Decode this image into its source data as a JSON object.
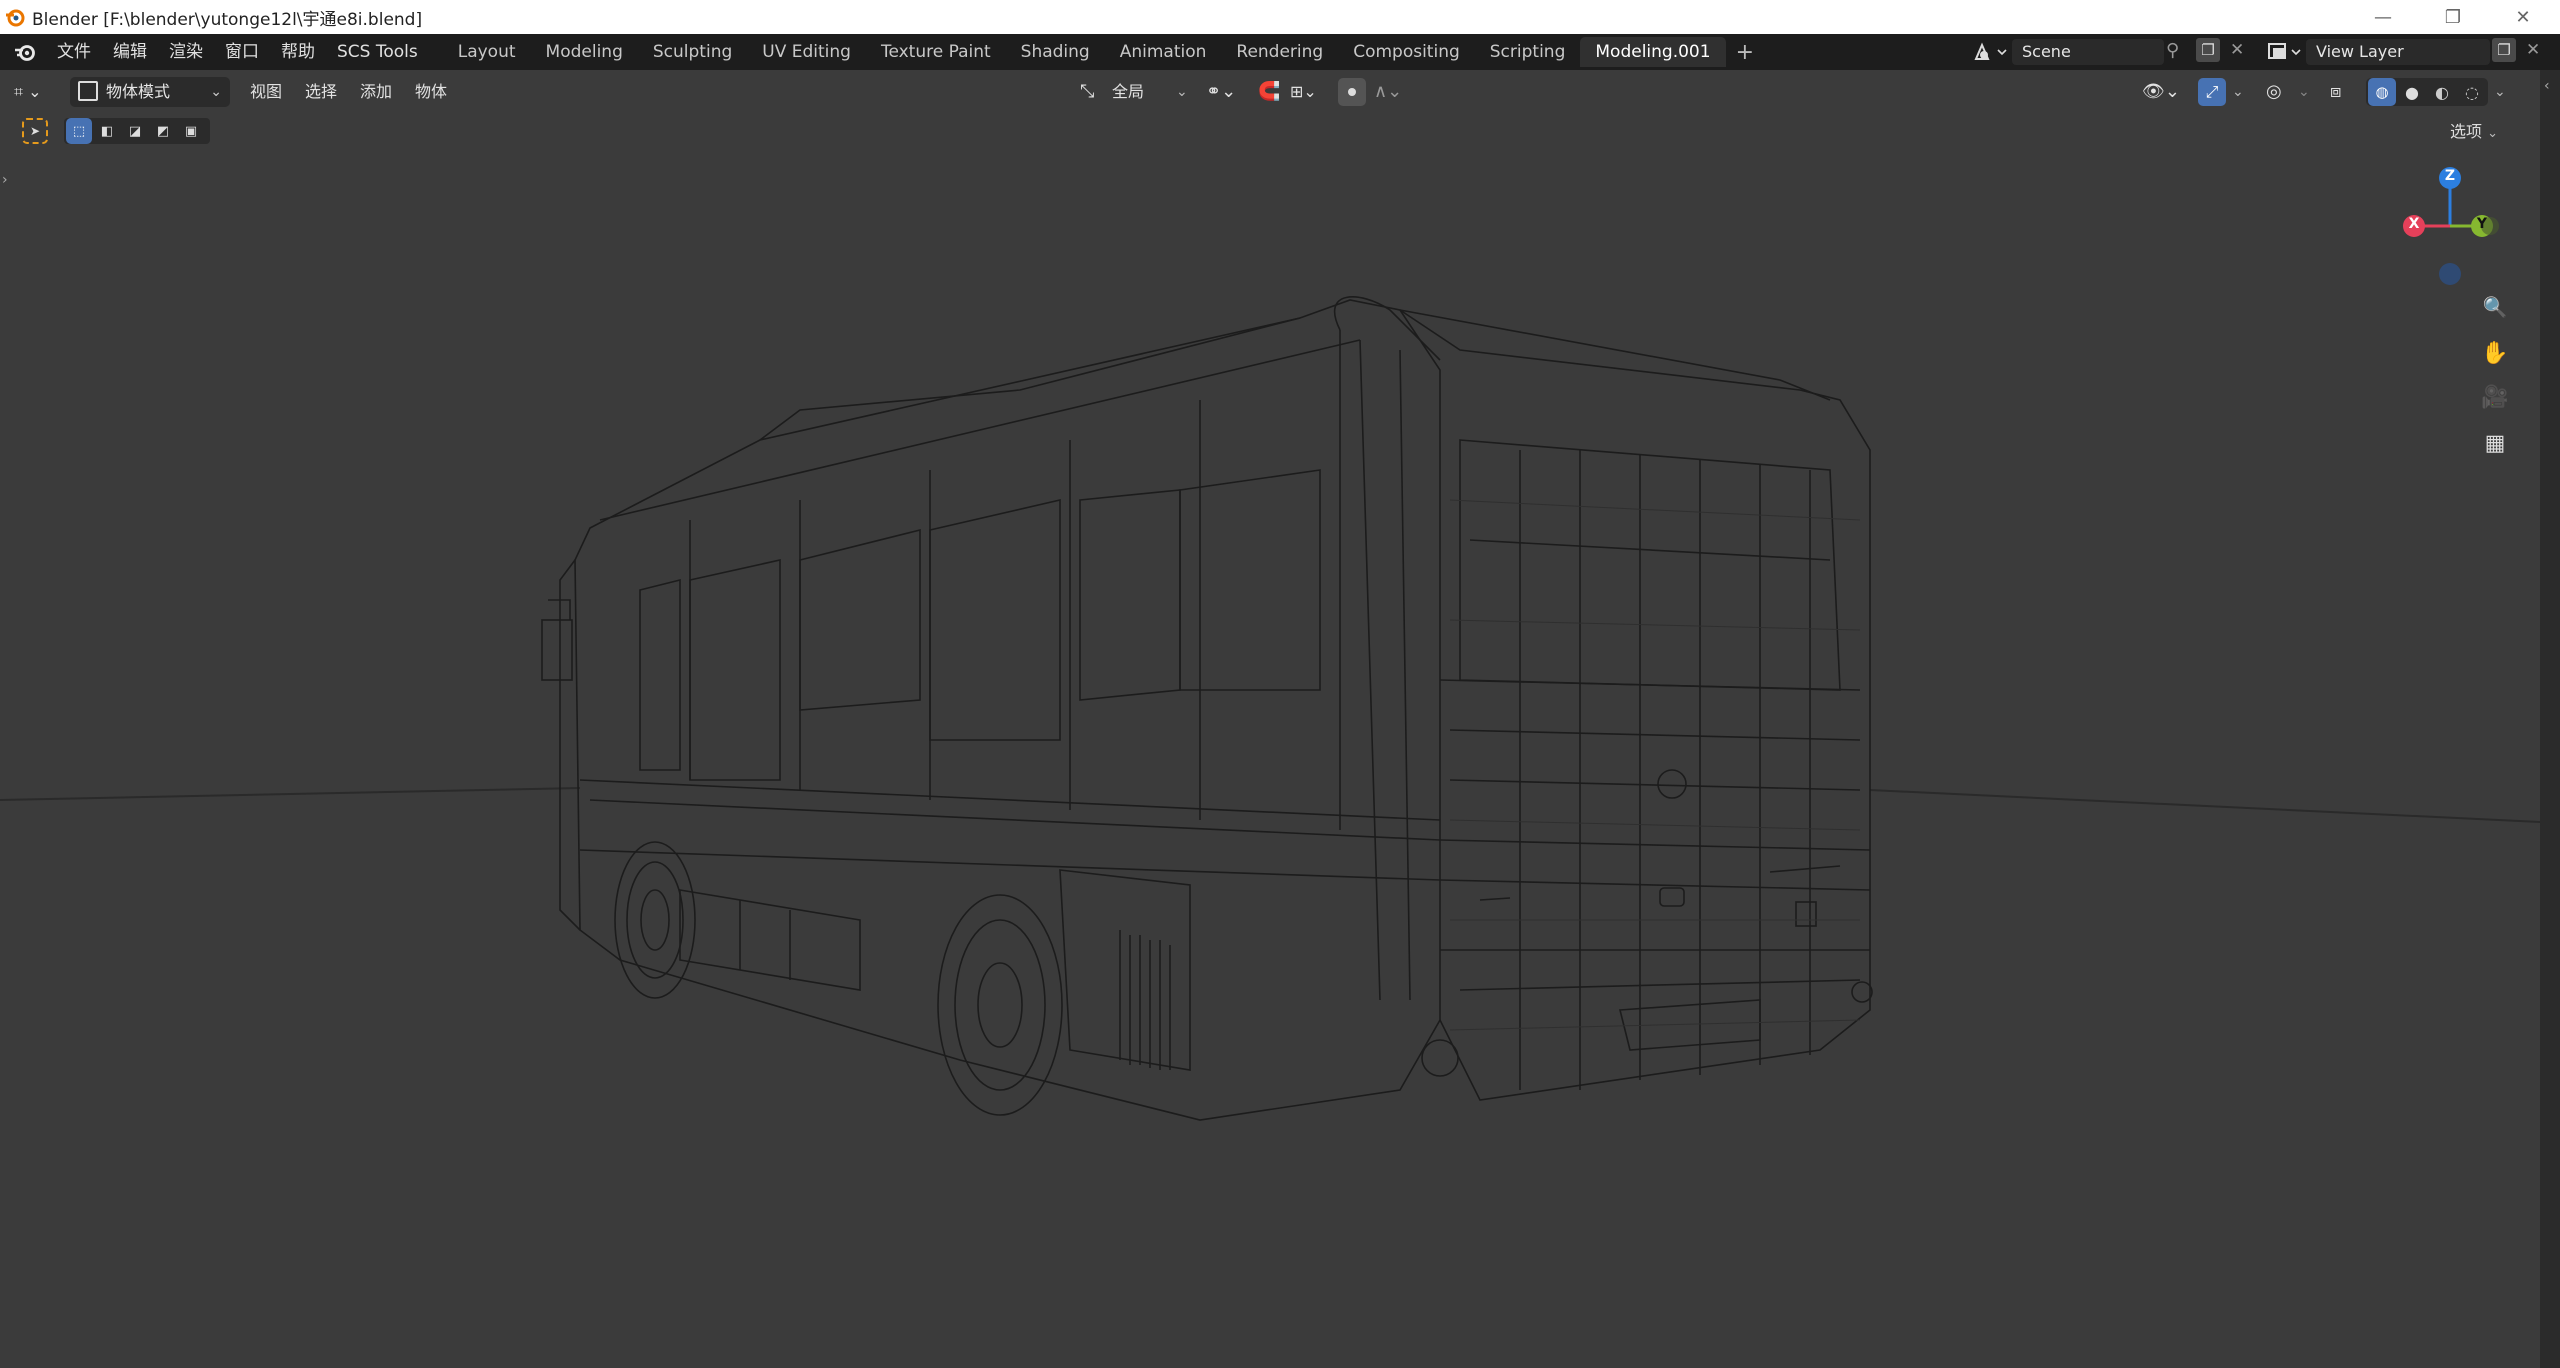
{
  "window": {
    "title": "Blender [F:\\blender\\yutonge12l\\宇通e8i.blend]"
  },
  "menu": {
    "items": [
      "文件",
      "编辑",
      "渲染",
      "窗口",
      "帮助",
      "SCS Tools"
    ]
  },
  "workspaces": {
    "tabs": [
      "Layout",
      "Modeling",
      "Sculpting",
      "UV Editing",
      "Texture Paint",
      "Shading",
      "Animation",
      "Rendering",
      "Compositing",
      "Scripting",
      "Modeling.001"
    ],
    "active": "Modeling.001",
    "add_icon": "plus-icon"
  },
  "scene": {
    "name": "Scene"
  },
  "view_layer": {
    "name": "View Layer"
  },
  "viewport_header": {
    "mode": "物体模式",
    "menus": [
      "视图",
      "选择",
      "添加",
      "物体"
    ],
    "transform_orientation": "全局",
    "options_label": "选项"
  },
  "gizmo": {
    "z": "Z",
    "x": "X",
    "y": "Y"
  },
  "colors": {
    "axis_x": "#e5405a",
    "axis_y": "#86b830",
    "axis_z": "#2c7fe0",
    "active_blue": "#4772b3"
  }
}
